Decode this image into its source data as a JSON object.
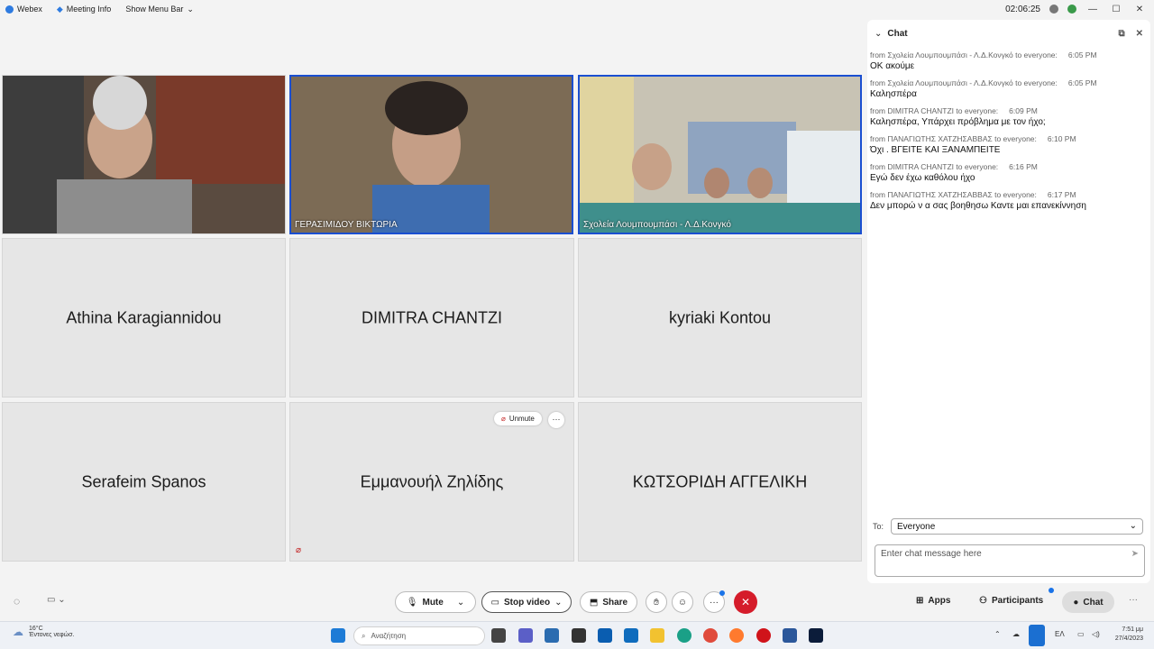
{
  "titlebar": {
    "app_name": "Webex",
    "meeting_info": "Meeting Info",
    "show_menu_bar": "Show Menu Bar",
    "timer": "02:06:25"
  },
  "tiles": {
    "video1": {
      "label": ""
    },
    "video2": {
      "label": "ΓΕΡΑΣΙΜΙΔΟΥ ΒΙΚΤΩΡΙΑ"
    },
    "video3": {
      "label": "Σχολεία Λουμπουμπάσι - Λ.Δ.Κονγκό"
    },
    "p1": "Athina Karagiannidou",
    "p2": "DIMITRA CHANTZI",
    "p3": "kyriaki Kontou",
    "p4": "Serafeim Spanos",
    "p5": "Εμμανουήλ Ζηλίδης",
    "p6": "ΚΩΤΣΟΡΙΔΗ ΑΓΓΕΛΙΚΗ",
    "unmute_label": "Unmute",
    "more_label": "···"
  },
  "chat": {
    "title": "Chat",
    "messages": [
      {
        "from": "from Σχολεία Λουμπουμπάσι - Λ.Δ.Κονγκό to everyone:",
        "time": "6:05 PM",
        "text": "ΟΚ ακούμε"
      },
      {
        "from": "from Σχολεία Λουμπουμπάσι - Λ.Δ.Κονγκό to everyone:",
        "time": "6:05 PM",
        "text": "Καλησπέρα"
      },
      {
        "from": "from DIMITRA CHANTZI to everyone:",
        "time": "6:09 PM",
        "text": "Καλησπέρα, Υπάρχει πρόβλημα με τον ήχο;"
      },
      {
        "from": "from ΠΑΝΑΓΙΩΤΗΣ ΧΑΤΖΗΣΑΒΒΑΣ to everyone:",
        "time": "6:10 PM",
        "text": "Όχι . ΒΓΕΙΤΕ ΚΑΙ ΞΑΝΑΜΠΕΙΤΕ"
      },
      {
        "from": "from DIMITRA CHANTZI to everyone:",
        "time": "6:16 PM",
        "text": "Εγώ δεν έχω καθόλου ήχο"
      },
      {
        "from": "from ΠΑΝΑΓΙΩΤΗΣ ΧΑΤΖΗΣΑΒΒΑΣ to everyone:",
        "time": "6:17 PM",
        "text": "Δεν  μπορώ ν α σας βοηθησω Καντε μαι επανεκίννηση"
      }
    ],
    "to_label": "To:",
    "to_value": "Everyone",
    "input_placeholder": "Enter chat message here"
  },
  "toolbar": {
    "mute": "Mute",
    "stop_video": "Stop video",
    "share": "Share",
    "apps": "Apps",
    "participants": "Participants",
    "chat": "Chat"
  },
  "taskbar": {
    "temperature": "16°C",
    "weather": "Έντονες νεφώσ.",
    "search": "Αναζήτηση",
    "lang": "ΕΛ",
    "time": "7:51 μμ",
    "date": "27/4/2023"
  }
}
